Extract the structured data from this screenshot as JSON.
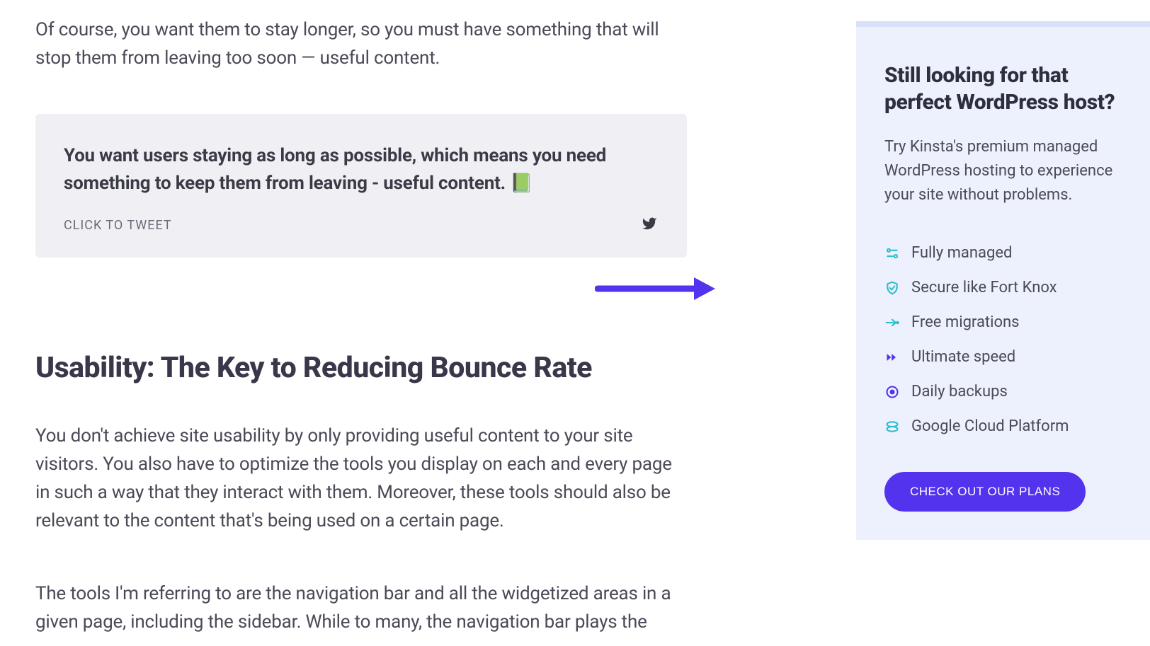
{
  "article": {
    "p1": "Of course, you want them to stay longer, so you must have something that will stop them from leaving too soon — useful content.",
    "tweet": {
      "text": "You want users staying as long as possible, which means you need something to keep them from leaving - useful content. 📗",
      "cta": "CLICK TO TWEET"
    },
    "h2": "Usability: The Key to Reducing Bounce Rate",
    "p3": "You don't achieve site usability by only providing useful content to your site visitors. You also have to optimize the tools you display on each and every page in such a way that they interact with them. Moreover, these tools should also be relevant to the content that's being used on a certain page.",
    "p4": "The tools I'm referring to are the navigation bar and all the widgetized areas in a given page, including the sidebar. While to many, the navigation bar plays the"
  },
  "sidebar": {
    "title": "Still looking for that perfect WordPress host?",
    "desc": "Try Kinsta's premium managed WordPress hosting to experience your site without problems.",
    "features": {
      "0": "Fully managed",
      "1": "Secure like Fort Knox",
      "2": "Free migrations",
      "3": "Ultimate speed",
      "4": "Daily backups",
      "5": "Google Cloud Platform"
    },
    "cta": "CHECK OUT OUR PLANS"
  }
}
